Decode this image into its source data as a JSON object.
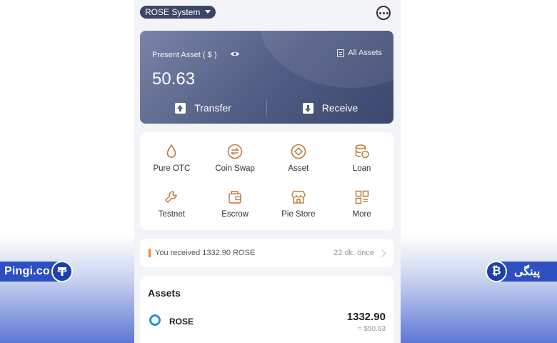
{
  "brand": {
    "left_text": "Pingi.co",
    "right_text": "پینگی",
    "left_logo_icon": "tether-icon",
    "right_logo_icon": "bitcoin-icon"
  },
  "header": {
    "network": "ROSE System",
    "chat_icon": "chat-bubble-icon"
  },
  "asset_card": {
    "label": "Present Asset ( $ )",
    "all_assets": "All Assets",
    "balance": "50.63",
    "transfer": "Transfer",
    "receive": "Receive"
  },
  "features": [
    {
      "label": "Pure OTC",
      "icon": "droplet-icon"
    },
    {
      "label": "Coin Swap",
      "icon": "swap-icon"
    },
    {
      "label": "Asset",
      "icon": "diamond-icon"
    },
    {
      "label": "Loan",
      "icon": "coins-stack-icon"
    },
    {
      "label": "Testnet",
      "icon": "wrench-icon"
    },
    {
      "label": "Escrow",
      "icon": "wallet-icon"
    },
    {
      "label": "Pie Store",
      "icon": "store-icon"
    },
    {
      "label": "More",
      "icon": "grid-icon"
    }
  ],
  "notice": {
    "message": "You received 1332.90  ROSE",
    "time": "22 dk. önce"
  },
  "assets": {
    "title": "Assets",
    "items": [
      {
        "name": "ROSE",
        "amount": "1332.90",
        "usd": "≈ $50.63"
      }
    ]
  },
  "colors": {
    "accent_orange": "#f08a24",
    "card_dark": "#3c4770",
    "brand_blue": "#2d4fc0"
  }
}
